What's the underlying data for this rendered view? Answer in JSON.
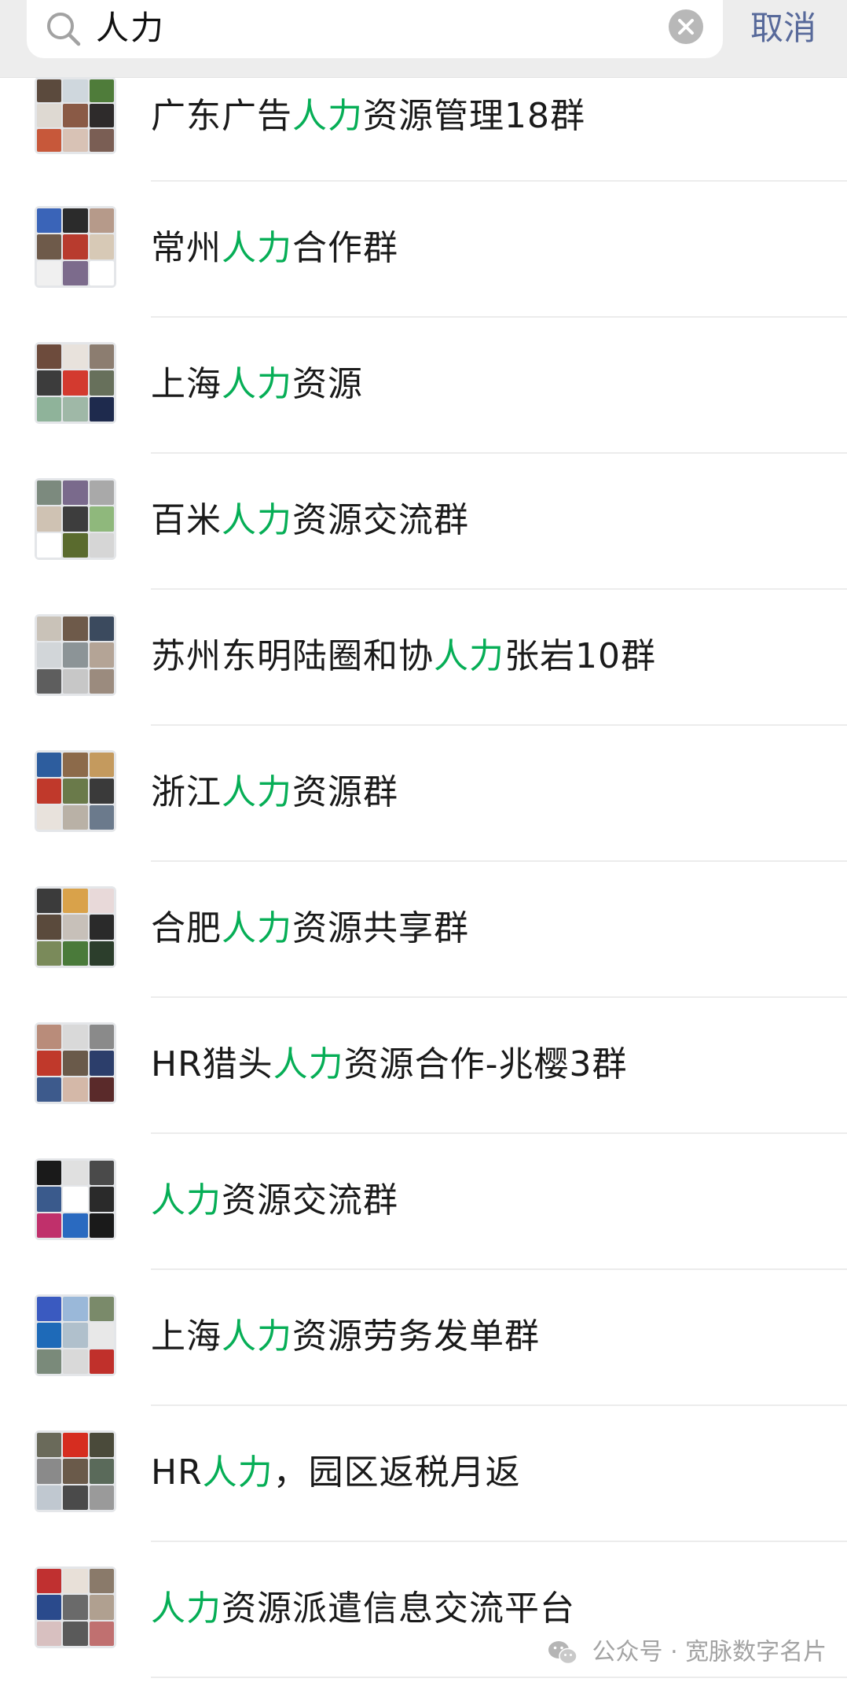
{
  "search": {
    "query": "人力",
    "cancel_label": "取消",
    "highlight_color": "#06ae56"
  },
  "results": [
    {
      "prefix": "广东广告",
      "match": "人力",
      "suffix": "资源管理18群",
      "avatar_colors": [
        "#5b4a3d",
        "#cfd7dd",
        "#4f7c3a",
        "#ded9d2",
        "#8a5a46",
        "#2e2b2b",
        "#c7583a",
        "#d8c2b5",
        "#7a5e54"
      ]
    },
    {
      "prefix": "常州",
      "match": "人力",
      "suffix": "合作群",
      "avatar_colors": [
        "#3a64b8",
        "#2b2b2b",
        "#b69a8a",
        "#6e5a4a",
        "#b83b2e",
        "#d7c9b6",
        "#f0f0f0",
        "#7c6b8c",
        "#ffffff"
      ]
    },
    {
      "prefix": "上海",
      "match": "人力",
      "suffix": "资源",
      "avatar_colors": [
        "#6d4b3c",
        "#e8e2dc",
        "#8c7d70",
        "#3c3c3c",
        "#d33a2f",
        "#67705b",
        "#8fb39a",
        "#9fb8a7",
        "#1e2a4d"
      ]
    },
    {
      "prefix": "百米",
      "match": "人力",
      "suffix": "资源交流群",
      "avatar_colors": [
        "#7c8a7e",
        "#7a6a8c",
        "#a9a9a9",
        "#cfc2b3",
        "#3d3d3d",
        "#8fb87c",
        "#ffffff",
        "#5a6b2e",
        "#d6d6d6"
      ]
    },
    {
      "prefix": "苏州东明陆圈和协",
      "match": "人力",
      "suffix": "张岩10群",
      "avatar_colors": [
        "#c9c2b8",
        "#6e5a4a",
        "#3b4a5e",
        "#d2d6d9",
        "#8c9497",
        "#b4a496",
        "#5e5e5e",
        "#c7c7c7",
        "#9b8b7e"
      ]
    },
    {
      "prefix": "浙江",
      "match": "人力",
      "suffix": "资源群",
      "avatar_colors": [
        "#2d5d9e",
        "#8c6a4a",
        "#c49a5e",
        "#c0392b",
        "#6a7a4a",
        "#3a3a3a",
        "#e8e2dc",
        "#b9b1a6",
        "#6b7a8c"
      ]
    },
    {
      "prefix": "合肥",
      "match": "人力",
      "suffix": "资源共享群",
      "avatar_colors": [
        "#3b3b3b",
        "#d9a24a",
        "#e8d9d9",
        "#5a4a3c",
        "#c7c0b9",
        "#2a2a2a",
        "#7a8a5a",
        "#4a7a3a",
        "#2c3e2c"
      ]
    },
    {
      "prefix": "HR猎头",
      "match": "人力",
      "suffix": "资源合作-兆樱3群",
      "avatar_colors": [
        "#b98c7a",
        "#d9d9d9",
        "#8a8a8a",
        "#c0392b",
        "#6a5a4a",
        "#2c3e6b",
        "#3d5a8c",
        "#d4b8a8",
        "#5a2a2a"
      ]
    },
    {
      "prefix": "",
      "match": "人力",
      "suffix": "资源交流群",
      "avatar_colors": [
        "#1a1a1a",
        "#e0e0e0",
        "#4a4a4a",
        "#3a5a8c",
        "#ffffff",
        "#2a2a2a",
        "#c0306b",
        "#2a6ac0",
        "#1a1a1a"
      ]
    },
    {
      "prefix": "上海",
      "match": "人力",
      "suffix": "资源劳务发单群",
      "avatar_colors": [
        "#3a5ac0",
        "#9ab8d9",
        "#7a8a6a",
        "#1e6ab8",
        "#b0c0cc",
        "#e8e8e8",
        "#7a8a7a",
        "#d9d9d9",
        "#c0302b"
      ]
    },
    {
      "prefix": "HR",
      "match": "人力",
      "suffix": "，园区返税月返",
      "avatar_colors": [
        "#6a6a5a",
        "#d62d20",
        "#4a4a3a",
        "#8a8a8a",
        "#6a5a4a",
        "#5a6a5a",
        "#c0c8d0",
        "#4a4a4a",
        "#9a9a9a"
      ]
    },
    {
      "prefix": "",
      "match": "人力",
      "suffix": "资源派遣信息交流平台",
      "avatar_colors": [
        "#c03030",
        "#e8e0d8",
        "#8a7a6a",
        "#2a4a8c",
        "#6a6a6a",
        "#b0a090",
        "#d8c0c0",
        "#5a5a5a",
        "#c07070"
      ]
    }
  ],
  "watermark": {
    "text": "公众号 · 宽脉数字名片"
  }
}
